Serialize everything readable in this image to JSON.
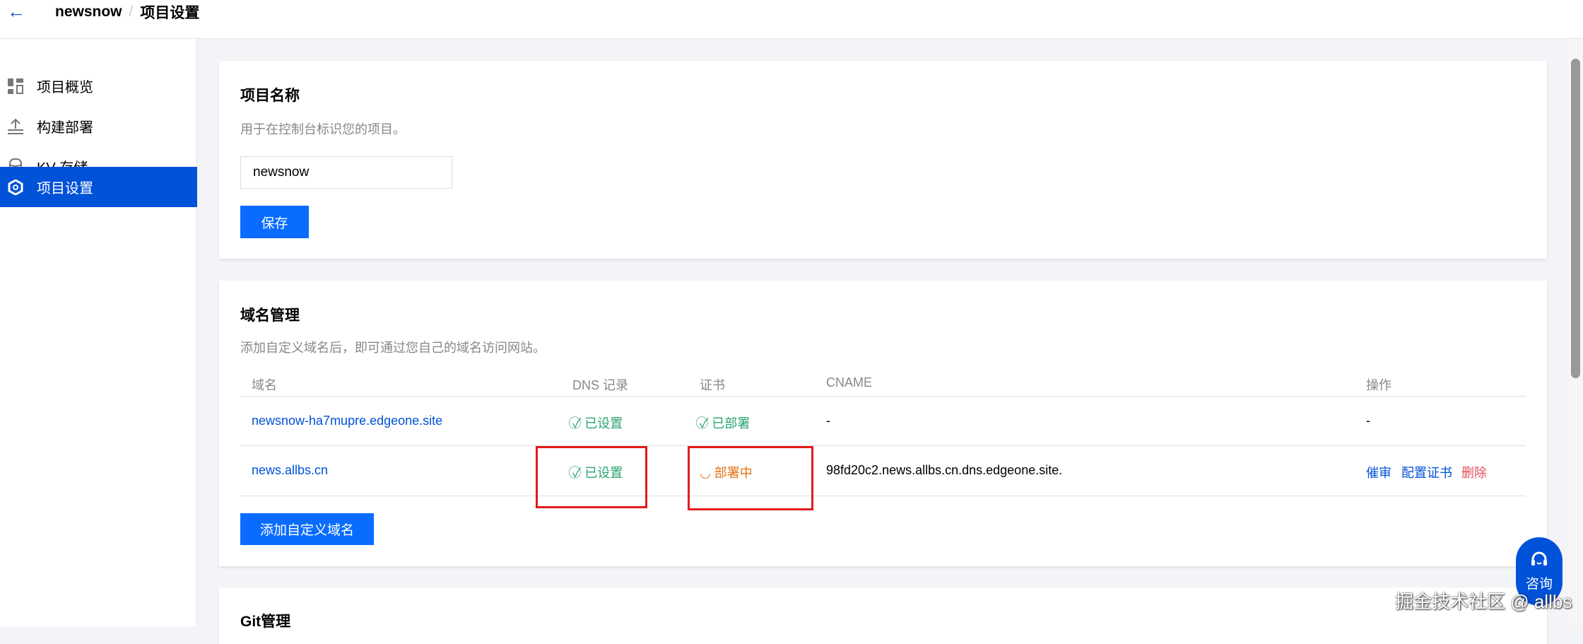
{
  "header": {
    "project": "newsnow",
    "separator": "/",
    "page": "项目设置"
  },
  "sidebar": {
    "items": [
      {
        "label": "项目概览"
      },
      {
        "label": "构建部署"
      },
      {
        "label": "KV 存储"
      },
      {
        "label": "项目设置"
      }
    ]
  },
  "name_card": {
    "title": "项目名称",
    "desc": "用于在控制台标识您的项目。",
    "input_value": "newsnow",
    "save_label": "保存"
  },
  "domain_card": {
    "title": "域名管理",
    "desc": "添加自定义域名后，即可通过您自己的域名访问网站。",
    "columns": [
      "域名",
      "DNS 记录",
      "证书",
      "CNAME",
      "操作"
    ],
    "rows": [
      {
        "domain": "newsnow-ha7mupre.edgeone.site",
        "dns": "已设置",
        "cert": "已部署",
        "cname": "-",
        "ops": "-"
      },
      {
        "domain": "news.allbs.cn",
        "dns": "已设置",
        "cert": "部署中",
        "cname": "98fd20c2.news.allbs.cn.dns.edgeone.site.",
        "actions": [
          "催审",
          "配置证书",
          "删除"
        ]
      }
    ],
    "add_label": "添加自定义域名"
  },
  "git_card": {
    "title": "Git管理"
  },
  "help": {
    "label": "咨询"
  },
  "watermark": "掘金技术社区 @ allbs"
}
